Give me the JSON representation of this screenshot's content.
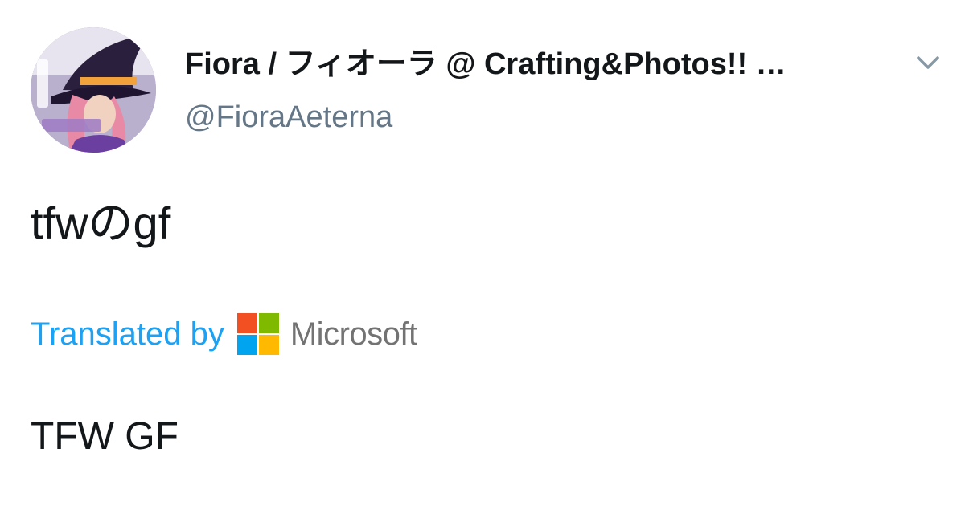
{
  "tweet": {
    "display_name": "Fiora / フィオーラ @ Crafting&Photos!! …",
    "handle": "@FioraAeterna",
    "text": "tfwのgf",
    "translation": {
      "label": "Translated by",
      "provider": "Microsoft",
      "text": "TFW GF"
    }
  },
  "icons": {
    "menu": "chevron-down-icon",
    "provider_logo": "microsoft-logo-icon"
  },
  "colors": {
    "text_primary": "#14171a",
    "text_secondary": "#657786",
    "link_blue": "#1da1f2",
    "ms_red": "#f25022",
    "ms_green": "#7fba00",
    "ms_blue": "#00a4ef",
    "ms_yellow": "#ffb900",
    "ms_gray": "#737373"
  }
}
